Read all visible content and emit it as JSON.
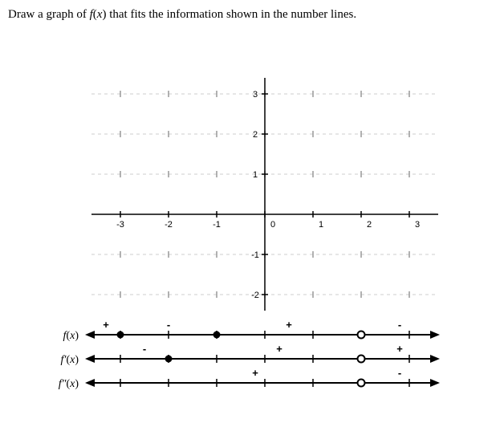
{
  "prompt": {
    "pre": "Draw a graph of ",
    "fn": "f",
    "var": "x",
    "post": " that fits the information shown in the number lines."
  },
  "chart_data": {
    "type": "diagram",
    "axes": {
      "x_ticks": [
        -3,
        -2,
        -1,
        0,
        1,
        2,
        3
      ],
      "y_ticks": [
        -2,
        -1,
        0,
        1,
        2,
        3
      ],
      "xlim": [
        -3.6,
        3.6
      ],
      "ylim": [
        -2.4,
        3.4
      ]
    },
    "number_lines": [
      {
        "label_tex": "f(x)",
        "marks": [
          {
            "x": -3,
            "type": "closed"
          },
          {
            "x": -1,
            "type": "closed"
          },
          {
            "x": 2,
            "type": "open"
          }
        ],
        "signs": [
          {
            "x": -3.3,
            "sign": "+"
          },
          {
            "x": -2,
            "sign": "-"
          },
          {
            "x": 0.5,
            "sign": "+"
          },
          {
            "x": 2.8,
            "sign": "-"
          }
        ]
      },
      {
        "label_tex": "f'(x)",
        "marks": [
          {
            "x": -2,
            "type": "closed"
          },
          {
            "x": 2,
            "type": "open"
          }
        ],
        "signs": [
          {
            "x": -2.5,
            "sign": "-"
          },
          {
            "x": 0.3,
            "sign": "+"
          },
          {
            "x": 2.8,
            "sign": "+"
          }
        ]
      },
      {
        "label_tex": "f''(x)",
        "marks": [
          {
            "x": 2,
            "type": "open"
          }
        ],
        "signs": [
          {
            "x": -0.2,
            "sign": "+"
          },
          {
            "x": 2.8,
            "sign": "-"
          }
        ]
      }
    ]
  }
}
